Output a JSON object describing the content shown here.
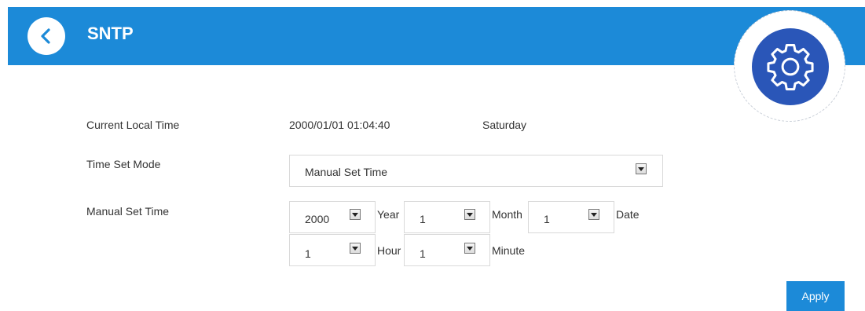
{
  "header": {
    "title": "SNTP",
    "back_icon": "chevron-left-icon",
    "settings_icon": "gear-icon",
    "accent_color": "#1c8ad8",
    "badge_color": "#2a56b8"
  },
  "form": {
    "current_local_time": {
      "label": "Current Local Time",
      "datetime": "2000/01/01 01:04:40",
      "weekday": "Saturday"
    },
    "time_set_mode": {
      "label": "Time Set Mode",
      "selected": "Manual Set Time"
    },
    "manual_set_time": {
      "label": "Manual Set Time",
      "year": {
        "value": "2000",
        "unit": "Year"
      },
      "month": {
        "value": "1",
        "unit": "Month"
      },
      "date": {
        "value": "1",
        "unit": "Date"
      },
      "hour": {
        "value": "1",
        "unit": "Hour"
      },
      "minute": {
        "value": "1",
        "unit": "Minute"
      }
    }
  },
  "actions": {
    "apply_label": "Apply"
  }
}
